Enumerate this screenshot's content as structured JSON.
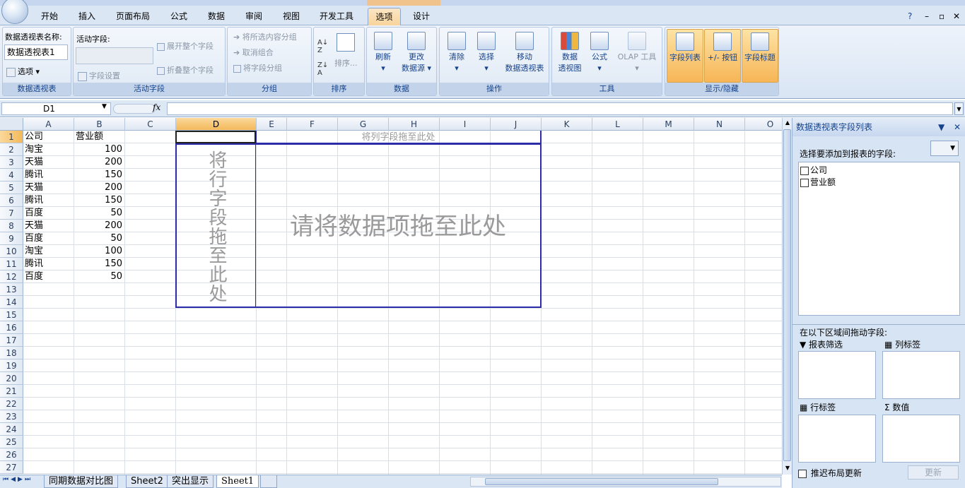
{
  "ribbon_tabs": [
    "开始",
    "插入",
    "页面布局",
    "公式",
    "数据",
    "审阅",
    "视图",
    "开发工具",
    "选项",
    "设计"
  ],
  "active_tab": "选项",
  "window_controls": {
    "help": "?",
    "minimize": "–",
    "restore": "▫",
    "close": "✕"
  },
  "ribbon": {
    "pivot_group": {
      "name_label": "数据透视表名称:",
      "name_value": "数据透视表1",
      "options_label": "选项",
      "group_label": "数据透视表"
    },
    "active_field_group": {
      "label": "活动字段:",
      "field_settings": "字段设置",
      "expand": "展开整个字段",
      "collapse": "折叠整个字段",
      "group_label": "活动字段"
    },
    "group_group": {
      "group_selection": "将所选内容分组",
      "ungroup": "取消组合",
      "group_field": "将字段分组",
      "group_label": "分组"
    },
    "sort_group": {
      "sort": "排序...",
      "group_label": "排序"
    },
    "data_group": {
      "refresh": "刷新",
      "change_source_1": "更改",
      "change_source_2": "数据源",
      "group_label": "数据"
    },
    "actions_group": {
      "clear": "清除",
      "select": "选择",
      "move_1": "移动",
      "move_2": "数据透视表",
      "group_label": "操作"
    },
    "tools_group": {
      "pivotchart_1": "数据",
      "pivotchart_2": "透视图",
      "formulas": "公式",
      "olap": "OLAP 工具",
      "group_label": "工具"
    },
    "show_group": {
      "field_list": "字段列表",
      "buttons": "+/- 按钮",
      "field_headers": "字段标题",
      "group_label": "显示/隐藏"
    }
  },
  "formula_bar": {
    "name_box": "D1",
    "fx": "fx",
    "formula": ""
  },
  "columns": [
    "A",
    "B",
    "C",
    "D",
    "E",
    "F",
    "G",
    "H",
    "I",
    "J",
    "K",
    "L",
    "M",
    "N",
    "O"
  ],
  "selected_column": "D",
  "rows": [
    "1",
    "2",
    "3",
    "4",
    "5",
    "6",
    "7",
    "8",
    "9",
    "10",
    "11",
    "12",
    "13",
    "14",
    "15",
    "16",
    "17",
    "18",
    "19",
    "20",
    "21",
    "22",
    "23",
    "24",
    "25",
    "26",
    "27"
  ],
  "selected_row": "1",
  "table": {
    "headers": [
      "公司",
      "营业额"
    ],
    "rows": [
      [
        "淘宝",
        "100"
      ],
      [
        "天猫",
        "200"
      ],
      [
        "腾讯",
        "150"
      ],
      [
        "天猫",
        "200"
      ],
      [
        "腾讯",
        "150"
      ],
      [
        "百度",
        "50"
      ],
      [
        "天猫",
        "200"
      ],
      [
        "百度",
        "50"
      ],
      [
        "淘宝",
        "100"
      ],
      [
        "腾讯",
        "150"
      ],
      [
        "百度",
        "50"
      ]
    ]
  },
  "pivot_placeholders": {
    "column": "将列字段拖至此处",
    "row": "将行字段拖至此处",
    "data": "请将数据项拖至此处"
  },
  "sheet_tabs": [
    "同期数据对比图",
    "Sheet2",
    "突出显示",
    "Sheet1"
  ],
  "active_sheet": "Sheet1",
  "field_list": {
    "title": "数据透视表字段列表",
    "choose_label": "选择要添加到报表的字段:",
    "fields": [
      "公司",
      "营业额"
    ],
    "drag_label": "在以下区域间拖动字段:",
    "report_filter": "报表筛选",
    "column_labels": "列标签",
    "row_labels": "行标签",
    "values": "数值",
    "defer_label": "推迟布局更新",
    "update_button": "更新"
  }
}
